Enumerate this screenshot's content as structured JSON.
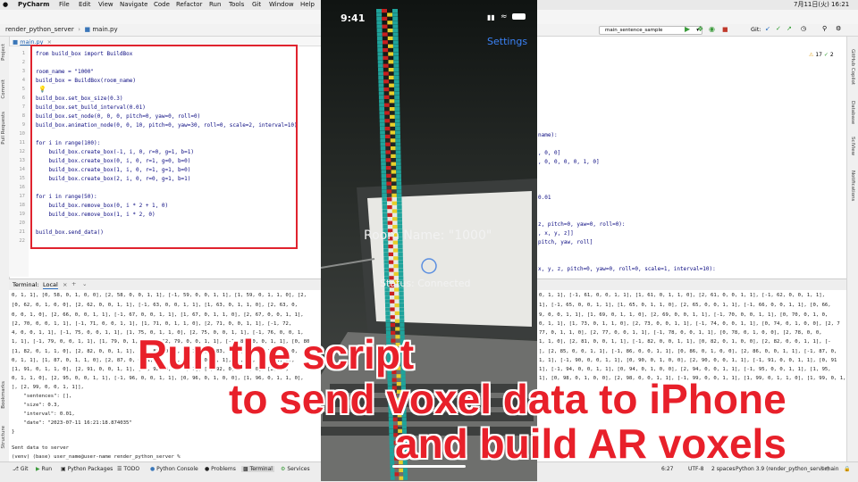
{
  "menubar": {
    "app": "PyCharm",
    "items": [
      "File",
      "Edit",
      "View",
      "Navigate",
      "Code",
      "Refactor",
      "Run",
      "Tools",
      "Git",
      "Window",
      "Help"
    ],
    "clock": "7月11日(火)  16:21"
  },
  "navbar": {
    "project": "render_python_server",
    "file": "main.py"
  },
  "tabs": {
    "active": "main.py"
  },
  "run_config": "main_sentence_sample",
  "git_label": "Git:",
  "side_tools": [
    "Project",
    "Commit",
    "Pull Requests",
    "Structure",
    "Bookmarks"
  ],
  "right_tools": [
    "GitHub Copilot",
    "Database",
    "SciView",
    "Notifications"
  ],
  "inspection": {
    "warnings": "17",
    "checks": "2"
  },
  "code": [
    {
      "n": "1",
      "t": "from build_box import BuildBox"
    },
    {
      "n": "2",
      "t": ""
    },
    {
      "n": "3",
      "t": "room_name = \"1000\""
    },
    {
      "n": "4",
      "t": "build_box = BuildBox(room_name)"
    },
    {
      "n": "5",
      "t": ""
    },
    {
      "n": "6",
      "t": "build_box.set_box_size(0.3)"
    },
    {
      "n": "7",
      "t": "build_box.set_build_interval(0.01)"
    },
    {
      "n": "8",
      "t": "build_box.set_node(0, 0, 0, pitch=0, yaw=0, roll=0)"
    },
    {
      "n": "9",
      "t": "build_box.animation_node(0, 0, 10, pitch=0, yaw=30, roll=0, scale=2, interval=10)"
    },
    {
      "n": "10",
      "t": ""
    },
    {
      "n": "11",
      "t": "for i in range(100):"
    },
    {
      "n": "12",
      "t": "    build_box.create_box(-1, i, 0, r=0, g=1, b=1)"
    },
    {
      "n": "13",
      "t": "    build_box.create_box(0, i, 0, r=1, g=0, b=0)"
    },
    {
      "n": "14",
      "t": "    build_box.create_box(1, i, 0, r=1, g=1, b=0)"
    },
    {
      "n": "15",
      "t": "    build_box.create_box(2, i, 0, r=0, g=1, b=1)"
    },
    {
      "n": "16",
      "t": ""
    },
    {
      "n": "17",
      "t": "for i in range(50):"
    },
    {
      "n": "18",
      "t": "    build_box.remove_box(0, i * 2 + 1, 0)"
    },
    {
      "n": "19",
      "t": "    build_box.remove_box(1, i * 2, 0)"
    },
    {
      "n": "20",
      "t": ""
    },
    {
      "n": "21",
      "t": "build_box.send_data()"
    },
    {
      "n": "22",
      "t": ""
    }
  ],
  "right_code": [
    "name):",
    ", 0, 0]",
    ", 0, 0, 0, 0, 1, 0]",
    "0.01",
    "z, pitch=0, yaw=0, roll=0):",
    ", x, y, z]]",
    "pitch, yaw, roll]",
    "x, y, z, pitch=0, yaw=0, roll=0, scale=1, interval=10):"
  ],
  "terminal": {
    "label": "Terminal:",
    "tab": "Local",
    "left_lines": [
      "0, 1, 1], [0, 58, 0, 1, 0, 0], [2, 58, 0, 0, 1, 1], [-1, 59, 0, 0, 1, 1], [1, 59, 0, 1, 1, 0], [2,",
      "[0, 62, 0, 1, 0, 0], [2, 62, 0, 0, 1, 1], [-1, 63, 0, 0, 1, 1], [1, 63, 0, 1, 1, 0], [2, 63, 0,",
      "0, 0, 1, 0], [2, 66, 0, 0, 1, 1], [-1, 67, 0, 0, 1, 1], [1, 67, 0, 1, 1, 0], [2, 67, 0, 0, 1, 1],",
      "[2, 70, 0, 0, 1, 1], [-1, 71, 0, 0, 1, 1], [1, 71, 0, 1, 1, 0], [2, 71, 0, 0, 1, 1], [-1, 72,",
      "4, 0, 0, 1, 1], [-1, 75, 0, 0, 1, 1], [1, 75, 0, 1, 1, 0], [2, 75, 0, 0, 1, 1], [-1, 76, 0, 0, 1,",
      "1, 1], [-1, 79, 0, 0, 1, 1], [1, 79, 0, 1, 1, 0], [2, 79, 0, 0, 1, 1], [-1, 80, 0, 0, 1, 1], [0, 80",
      "[1, 82, 0, 1, 1, 0], [2, 82, 0, 0, 1, 1], [-1, 83, 0, 0, 1, 1], [1, 83, 0, 1, 1, 0], [2, 83, 0,",
      "0, 1, 1], [1, 87, 0, 1, 1, 0], [2, 87, 0, 0, 1, 1], [-1, 88, 0, 0, 1, 1], [1, 88, 0, 1, 1, 0],",
      "[1, 91, 0, 1, 1, 0], [2, 91, 0, 0, 1, 1], [-1, 92, 0, 0, 1, 1], [1, 92, 0, 1, 1, 0], [2, 92,",
      "0, 1, 1, 0], [2, 95, 0, 0, 1, 1], [-1, 96, 0, 0, 1, 1], [0, 96, 0, 1, 0, 0], [1, 96, 0, 1, 1, 0],",
      "], [2, 99, 0, 0, 1, 1]],",
      "    \"sentences\": [],",
      "    \"size\": 0.3,",
      "    \"interval\": 0.01,",
      "    \"date\": \"2023-07-11 16:21:18.874035\"",
      "}",
      "",
      "Sent data to server",
      "(venv) (base) user_name@user-name render_python_server %"
    ],
    "right_lines": [
      "0, 1, 1], [-1, 61, 0, 0, 1, 1], [1, 61, 0, 1, 1, 0], [2, 61, 0, 0, 1, 1], [-1, 62, 0, 0, 1, 1],",
      "1], [-1, 65, 0, 0, 1, 1], [1, 65, 0, 1, 1, 0], [2, 65, 0, 0, 1, 1], [-1, 66, 0, 0, 1, 1], [0, 66,",
      "9, 0, 0, 1, 1], [1, 69, 0, 1, 1, 0], [2, 69, 0, 0, 1, 1], [-1, 70, 0, 0, 1, 1], [0, 70, 0, 1, 0,",
      "0, 1, 1], [1, 73, 0, 1, 1, 0], [2, 73, 0, 0, 1, 1], [-1, 74, 0, 0, 1, 1], [0, 74, 0, 1, 0, 0], [2, 7",
      "77, 0, 1, 1, 0], [2, 77, 0, 0, 1, 1], [-1, 78, 0, 0, 1, 1], [0, 78, 0, 1, 0, 0], [2, 78, 0, 0,",
      "1, 1, 0], [2, 81, 0, 0, 1, 1], [-1, 82, 0, 0, 1, 1], [0, 82, 0, 1, 0, 0], [2, 82, 0, 0, 1, 1], [-",
      "], [2, 85, 0, 0, 1, 1], [-1, 86, 0, 0, 1, 1], [0, 86, 0, 1, 0, 0], [2, 86, 0, 0, 1, 1], [-1, 87, 0,",
      "1, 1], [-1, 90, 0, 0, 1, 1], [0, 90, 0, 1, 0, 0], [2, 90, 0, 0, 1, 1], [-1, 91, 0, 0, 1, 1], [0, 91",
      "1], [-1, 94, 0, 0, 1, 1], [0, 94, 0, 1, 0, 0], [2, 94, 0, 0, 1, 1], [-1, 95, 0, 0, 1, 1], [1, 95,",
      "1], [0, 98, 0, 1, 0, 0], [2, 98, 0, 0, 1, 1], [-1, 99, 0, 0, 1, 1], [1, 99, 0, 1, 1, 0], [1, 99, 0, 1,"
    ]
  },
  "bottom_tools": [
    "Git",
    "Run",
    "Python Packages",
    "TODO",
    "Python Console",
    "Problems",
    "Terminal",
    "Services"
  ],
  "status_bar": {
    "position": "6:27",
    "encoding": "UTF-8",
    "indent": "2 spaces",
    "interpreter": "Python 3.9 (render_python_server)",
    "branch": "main"
  },
  "phone": {
    "time": "9:41",
    "settings": "Settings",
    "room_name": "Room Name: \"1000\"",
    "status": "Status: Connected"
  },
  "caption": {
    "line1": "Run the script",
    "line2": "to send voxel data to iPhone",
    "line3": "and build AR voxels"
  },
  "colors": {
    "caption_red": "#e8202a",
    "highlight_box": "#e0232e",
    "voxel_red": "#c8201e",
    "voxel_yellow": "#e6cf2a",
    "voxel_cyan": "#1fa39b"
  }
}
